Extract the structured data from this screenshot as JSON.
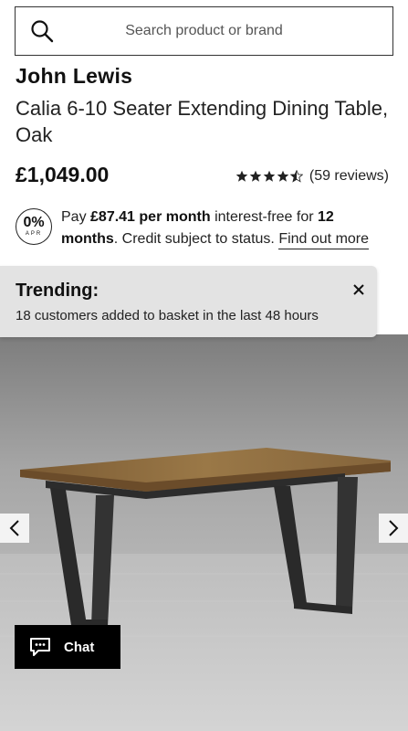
{
  "search": {
    "placeholder": "Search product or brand",
    "icon": "search-icon"
  },
  "product": {
    "brand": "John Lewis",
    "title": "Calia 6-10 Seater Extending Dining Table, Oak",
    "price": "£1,049.00",
    "rating": {
      "stars": 4.5,
      "max": 5,
      "reviews_label": "(59 reviews)"
    }
  },
  "finance": {
    "badge_pct": "0%",
    "badge_apr": "APR",
    "pay_text": "Pay ",
    "monthly": "£87.41 per month",
    "interest_text": " interest-free for ",
    "months": "12 months",
    "status_text": ". Credit subject to status. ",
    "link_label": "Find out more"
  },
  "trending": {
    "heading": "Trending:",
    "message": "18 customers added to basket in the last 48 hours"
  },
  "chat": {
    "label": "Chat"
  },
  "colors": {
    "trending_bg": "#e3e3e3",
    "chat_bg": "#000000",
    "wood": "#8a6a3e"
  }
}
